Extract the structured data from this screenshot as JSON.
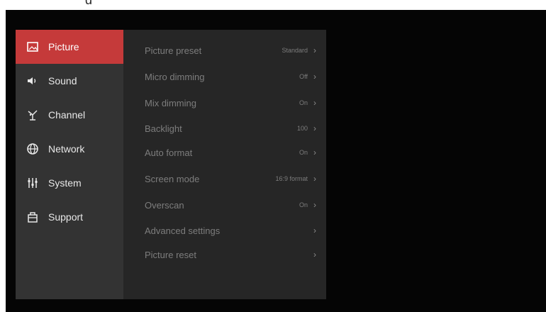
{
  "sidebar": {
    "items": [
      {
        "label": "Picture",
        "icon": "picture-icon",
        "active": true
      },
      {
        "label": "Sound",
        "icon": "speaker-icon",
        "active": false
      },
      {
        "label": "Channel",
        "icon": "antenna-icon",
        "active": false
      },
      {
        "label": "Network",
        "icon": "globe-icon",
        "active": false
      },
      {
        "label": "System",
        "icon": "sliders-icon",
        "active": false
      },
      {
        "label": "Support",
        "icon": "support-icon",
        "active": false
      }
    ]
  },
  "picture_settings": {
    "rows": [
      {
        "label": "Picture preset",
        "value": "Standard"
      },
      {
        "label": "Micro dimming",
        "value": "Off"
      },
      {
        "label": "Mix dimming",
        "value": "On"
      },
      {
        "label": "Backlight",
        "value": "100"
      },
      {
        "label": "Auto format",
        "value": "On"
      },
      {
        "label": "Screen mode",
        "value": "16:9 format"
      },
      {
        "label": "Overscan",
        "value": "On"
      },
      {
        "label": "Advanced settings",
        "value": ""
      },
      {
        "label": "Picture reset",
        "value": ""
      }
    ]
  },
  "colors": {
    "active_accent": "#c53a3a",
    "sidebar_bg": "#333333",
    "content_bg": "#262626",
    "screen_bg": "#050505"
  }
}
